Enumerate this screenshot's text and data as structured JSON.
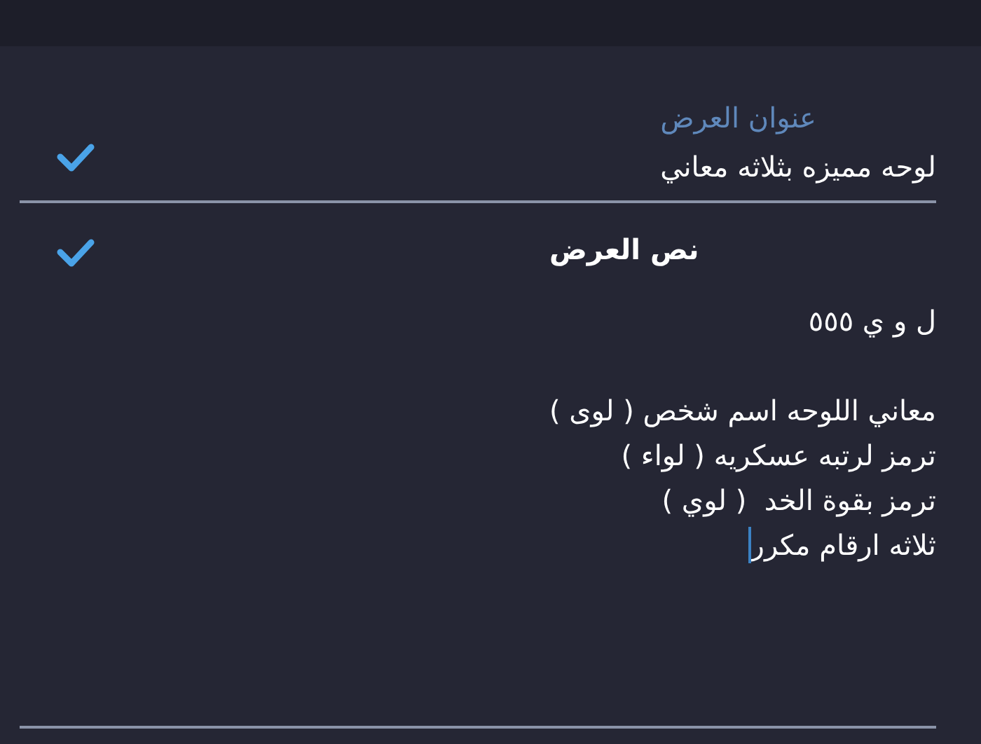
{
  "fields": [
    {
      "kind": "floating",
      "label": "عنوان العرض",
      "paragraphs": [
        [
          "لوحه مميزه بثلاثه معاني"
        ]
      ],
      "checked": true
    },
    {
      "kind": "heading",
      "label": "نص العرض",
      "paragraphs": [
        [
          "ل و ي ٥٥٥"
        ],
        [
          "معاني اللوحه اسم شخص ( لوى )",
          "ترمز لرتبه عسكريه ( لواء )",
          "ترمز بقوة الخد  ( لوي )",
          "ثلاثه ارقام مكرر"
        ]
      ],
      "checked": true,
      "focused": true
    }
  ]
}
